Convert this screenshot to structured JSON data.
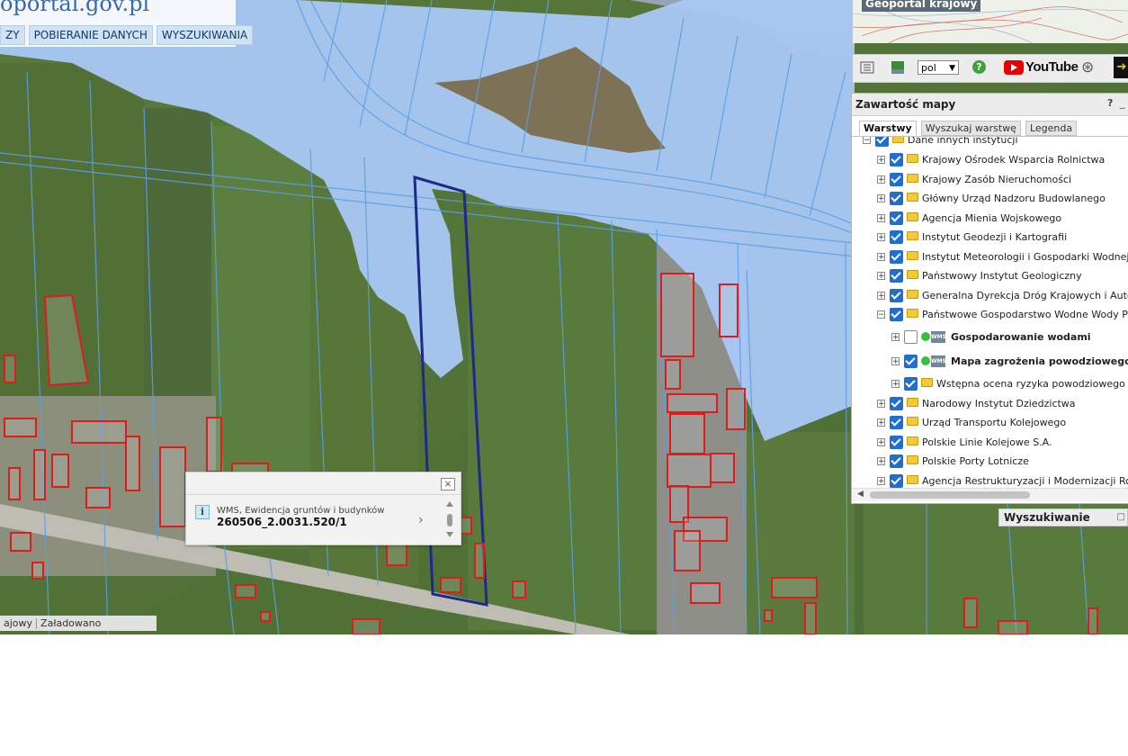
{
  "header": {
    "logo_text": "oportal.gov.pl",
    "menu": [
      "ZY",
      "POBIERANIE DANYCH",
      "WYSZUKIWANIA"
    ]
  },
  "status_bar": {
    "left": "ajowy",
    "right": "Załadowano"
  },
  "popup": {
    "source": "WMS, Ewidencja gruntów i budynków",
    "value": "260506_2.0031.520/1",
    "info_icon": "i",
    "close_icon": "×",
    "next_icon": "›"
  },
  "minimap": {
    "title": "Geoportal krajowy"
  },
  "toolbar": {
    "language": "pol",
    "help": "?",
    "youtube": "YouTube"
  },
  "panel": {
    "title": "Zawartość mapy",
    "help": "?",
    "minimize": "_",
    "tabs": [
      "Warstwy",
      "Wyszukaj warstwę",
      "Legenda"
    ],
    "active_tab": "Warstwy",
    "tree": [
      {
        "label": "Dane innych instytucji",
        "level": 0,
        "expanded": true,
        "checked": true,
        "type": "folder"
      },
      {
        "label": "Krajowy Ośrodek Wsparcia Rolnictwa",
        "level": 1,
        "expanded": false,
        "checked": true,
        "type": "folder"
      },
      {
        "label": "Krajowy Zasób Nieruchomości",
        "level": 1,
        "expanded": false,
        "checked": true,
        "type": "folder"
      },
      {
        "label": "Główny Urząd Nadzoru Budowlanego",
        "level": 1,
        "expanded": false,
        "checked": true,
        "type": "folder"
      },
      {
        "label": "Agencja Mienia Wojskowego",
        "level": 1,
        "expanded": false,
        "checked": true,
        "type": "folder"
      },
      {
        "label": "Instytut Geodezji i Kartografii",
        "level": 1,
        "expanded": false,
        "checked": true,
        "type": "folder"
      },
      {
        "label": "Instytut Meteorologii i Gospodarki Wodnej",
        "level": 1,
        "expanded": false,
        "checked": true,
        "type": "folder"
      },
      {
        "label": "Państwowy Instytut Geologiczny",
        "level": 1,
        "expanded": false,
        "checked": true,
        "type": "folder"
      },
      {
        "label": "Generalna Dyrekcja Dróg Krajowych i Autostrad",
        "level": 1,
        "expanded": false,
        "checked": true,
        "type": "folder"
      },
      {
        "label": "Państwowe Gospodarstwo Wodne Wody Polskie",
        "level": 1,
        "expanded": true,
        "checked": true,
        "type": "folder"
      },
      {
        "label": "Gospodarowanie wodami",
        "level": 2,
        "expanded": false,
        "checked": false,
        "type": "wms"
      },
      {
        "label": "Mapa zagrożenia powodziowego",
        "level": 2,
        "expanded": false,
        "checked": true,
        "type": "wms"
      },
      {
        "label": "Wstępna ocena ryzyka powodziowego",
        "level": 2,
        "expanded": false,
        "checked": true,
        "type": "folder"
      },
      {
        "label": "Narodowy Instytut Dziedzictwa",
        "level": 1,
        "expanded": false,
        "checked": true,
        "type": "folder"
      },
      {
        "label": "Urząd Transportu Kolejowego",
        "level": 1,
        "expanded": false,
        "checked": true,
        "type": "folder"
      },
      {
        "label": "Polskie Linie Kolejowe S.A.",
        "level": 1,
        "expanded": false,
        "checked": true,
        "type": "folder"
      },
      {
        "label": "Polskie Porty Lotnicze",
        "level": 1,
        "expanded": false,
        "checked": true,
        "type": "folder"
      },
      {
        "label": "Agencja Restrukturyzacji i Modernizacji Rolnictwa",
        "level": 1,
        "expanded": false,
        "checked": true,
        "type": "folder"
      }
    ]
  },
  "search_panel": {
    "title": "Wyszukiwanie",
    "icon": "□"
  },
  "colors": {
    "flood_zone": "#a9c8f5",
    "parcel_line": "#5aa0e6",
    "building_outline": "#e01b1b",
    "selected_parcel": "#1c2a8c",
    "checkbox": "#1f6fd1"
  }
}
